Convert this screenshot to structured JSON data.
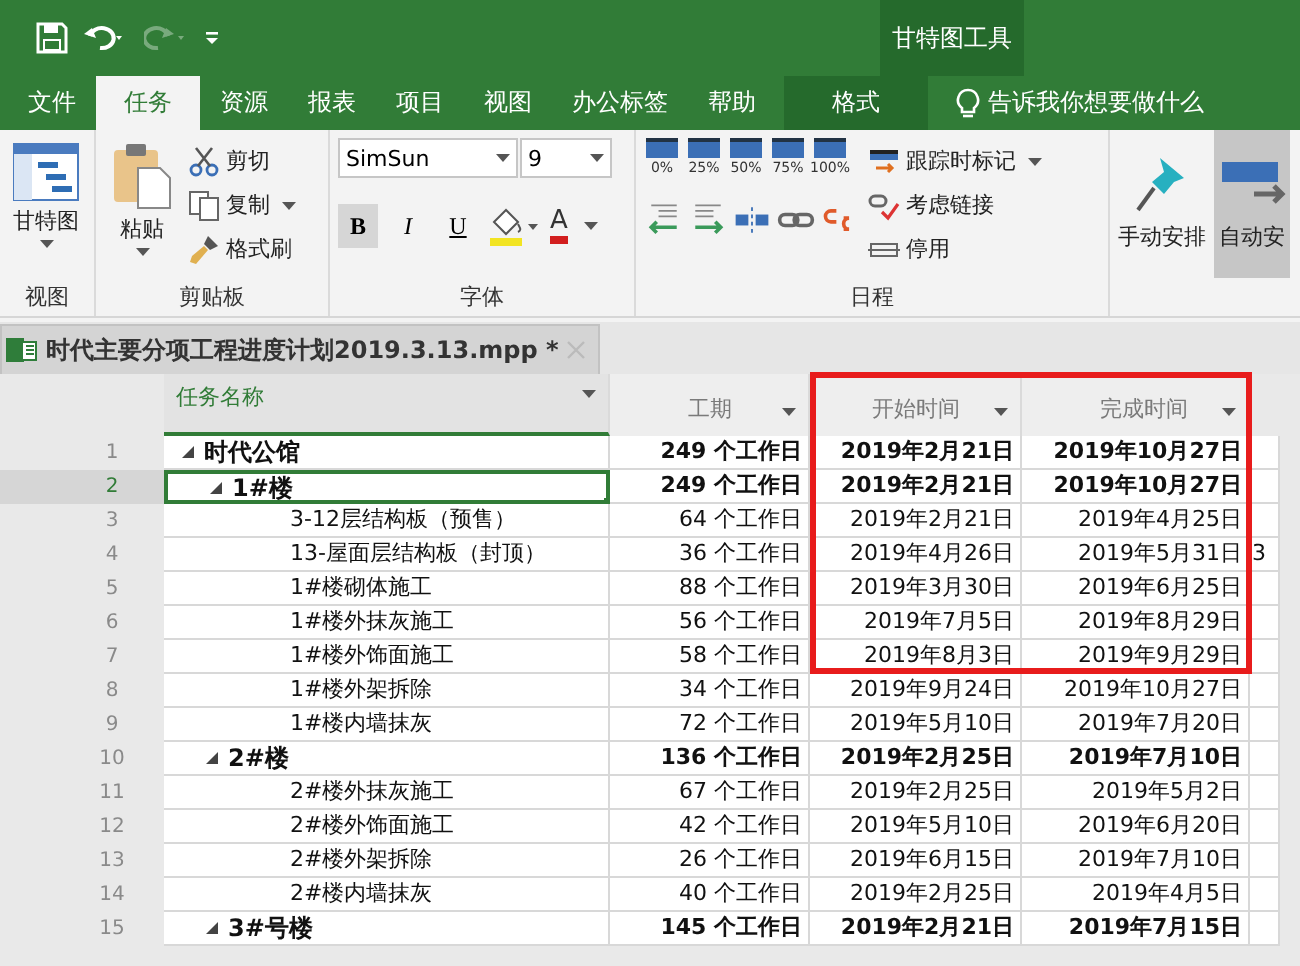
{
  "title_bar": {
    "contextual_group": "甘特图工具",
    "redo_disabled": true
  },
  "ribbon_tabs": [
    {
      "label": "文件",
      "selected": false,
      "kind": "normal"
    },
    {
      "label": "任务",
      "selected": true,
      "kind": "normal"
    },
    {
      "label": "资源",
      "selected": false,
      "kind": "normal"
    },
    {
      "label": "报表",
      "selected": false,
      "kind": "normal"
    },
    {
      "label": "项目",
      "selected": false,
      "kind": "normal"
    },
    {
      "label": "视图",
      "selected": false,
      "kind": "normal"
    },
    {
      "label": "办公标签",
      "selected": false,
      "kind": "normal"
    },
    {
      "label": "帮助",
      "selected": false,
      "kind": "normal"
    },
    {
      "label": "格式",
      "selected": false,
      "kind": "contextual"
    }
  ],
  "tell_me": "告诉我你想要做什么",
  "ribbon": {
    "view_group": {
      "button": "甘特图",
      "label": "视图"
    },
    "clipboard_group": {
      "paste": "粘贴",
      "cut": "剪切",
      "copy": "复制",
      "format_painter": "格式刷",
      "label": "剪贴板"
    },
    "font_group": {
      "font": "SimSun",
      "size": "9",
      "bold": "B",
      "italic": "I",
      "underline": "U",
      "font_color": "A",
      "label": "字体"
    },
    "schedule_group": {
      "percent_buttons": [
        "0%",
        "25%",
        "50%",
        "75%",
        "100%"
      ],
      "mark_on_track": "跟踪时标记",
      "respect_links": "考虑链接",
      "inactivate": "停用",
      "label": "日程"
    },
    "manual_schedule": "手动安排",
    "auto_schedule": "自动安"
  },
  "document_tab": {
    "title": "时代主要分项工程进度计划2019.3.13.mpp *"
  },
  "table": {
    "columns": [
      {
        "label": "任务名称"
      },
      {
        "label": "工期"
      },
      {
        "label": "开始时间"
      },
      {
        "label": "完成时间"
      }
    ],
    "rows": [
      {
        "number": "1",
        "name": "时代公馆",
        "duration": "249  个工作日",
        "start": "2019年2月21日",
        "finish": "2019年10月27日",
        "summary": true,
        "expanded": true,
        "selected": false,
        "children": [
          {
            "number": "2",
            "name": "1#楼",
            "duration": "249  个工作日",
            "start": "2019年2月21日",
            "finish": "2019年10月27日",
            "summary": true,
            "expanded": true,
            "selected": true,
            "children": [
              {
                "number": "3",
                "name": "3-12层结构板（预售）",
                "duration": "64  个工作日",
                "start": "2019年2月21日",
                "finish": "2019年4月25日",
                "summary": false,
                "selected": false
              },
              {
                "number": "4",
                "name": "13-屋面层结构板（封顶）",
                "duration": "36  个工作日",
                "start": "2019年4月26日",
                "finish": "2019年5月31日",
                "column_5": "3",
                "summary": false,
                "selected": false
              },
              {
                "number": "5",
                "name": "1#楼砌体施工",
                "duration": "88  个工作日",
                "start": "2019年3月30日",
                "finish": "2019年6月25日",
                "summary": false,
                "selected": false
              },
              {
                "number": "6",
                "name": "1#楼外抹灰施工",
                "duration": "56  个工作日",
                "start": "2019年7月5日",
                "finish": "2019年8月29日",
                "summary": false,
                "selected": false
              },
              {
                "number": "7",
                "name": "1#楼外饰面施工",
                "duration": "58  个工作日",
                "start": "2019年8月3日",
                "finish": "2019年9月29日",
                "summary": false,
                "selected": false
              },
              {
                "number": "8",
                "name": "1#楼外架拆除",
                "duration": "34  个工作日",
                "start": "2019年9月24日",
                "finish": "2019年10月27日",
                "summary": false,
                "selected": false
              },
              {
                "number": "9",
                "name": "1#楼内墙抹灰",
                "duration": "72  个工作日",
                "start": "2019年5月10日",
                "finish": "2019年7月20日",
                "summary": false,
                "selected": false
              }
            ]
          },
          {
            "number": "10",
            "name": "2#楼",
            "duration": "136  个工作日",
            "start": "2019年2月25日",
            "finish": "2019年7月10日",
            "summary": true,
            "expanded": true,
            "selected": false,
            "children": [
              {
                "number": "11",
                "name": "2#楼外抹灰施工",
                "duration": "67  个工作日",
                "start": "2019年2月25日",
                "finish": "2019年5月2日",
                "summary": false,
                "selected": false
              },
              {
                "number": "12",
                "name": "2#楼外饰面施工",
                "duration": "42  个工作日",
                "start": "2019年5月10日",
                "finish": "2019年6月20日",
                "summary": false,
                "selected": false
              },
              {
                "number": "13",
                "name": "2#楼外架拆除",
                "duration": "26  个工作日",
                "start": "2019年6月15日",
                "finish": "2019年7月10日",
                "summary": false,
                "selected": false
              },
              {
                "number": "14",
                "name": "2#楼内墙抹灰",
                "duration": "40  个工作日",
                "start": "2019年2月25日",
                "finish": "2019年4月5日",
                "summary": false,
                "selected": false
              }
            ]
          },
          {
            "number": "15",
            "name": "3#号楼",
            "duration": "145  个工作日",
            "start": "2019年2月21日",
            "finish": "2019年7月15日",
            "summary": true,
            "expanded": true,
            "selected": false
          }
        ]
      }
    ]
  }
}
